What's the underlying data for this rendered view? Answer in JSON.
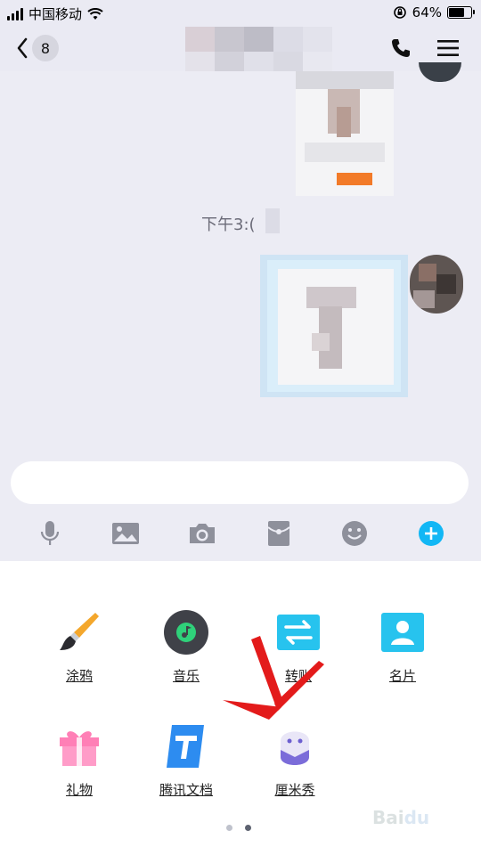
{
  "status_bar": {
    "carrier": "中国移动",
    "battery_percent": "64%",
    "battery_level": 0.64
  },
  "nav": {
    "back_icon": "chevron-left-icon",
    "unread_count": "8",
    "phone_icon": "phone-icon",
    "menu_icon": "hamburger-menu-icon"
  },
  "chat": {
    "timestamp": "下午3:("
  },
  "toolbar": {
    "icons": [
      "microphone-icon",
      "image-icon",
      "camera-icon",
      "red-packet-icon",
      "emoji-icon",
      "plus-icon"
    ],
    "accent": "#12b7f5"
  },
  "apps": [
    {
      "label": "涂鸦",
      "icon": "paintbrush-icon"
    },
    {
      "label": "音乐",
      "icon": "music-icon"
    },
    {
      "label": "转账",
      "icon": "transfer-icon"
    },
    {
      "label": "名片",
      "icon": "contact-card-icon"
    },
    {
      "label": "礼物",
      "icon": "gift-icon"
    },
    {
      "label": "腾讯文档",
      "icon": "tencent-docs-icon"
    },
    {
      "label": "厘米秀",
      "icon": "cmshow-icon"
    }
  ],
  "pager": {
    "page": 2,
    "pages": 2
  },
  "watermark": {
    "text": "Baidu经验",
    "url": "jingyan.baidu.com"
  }
}
